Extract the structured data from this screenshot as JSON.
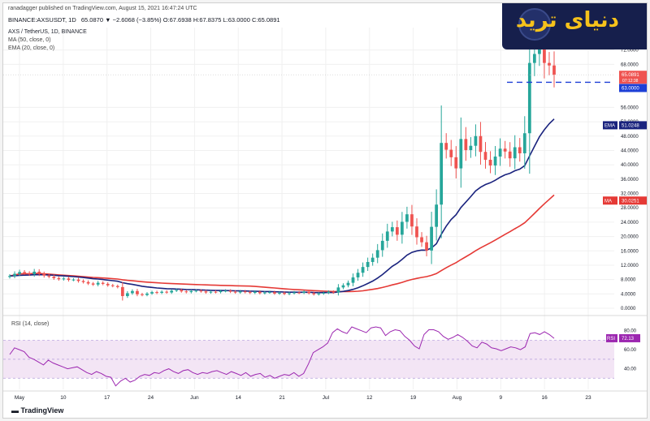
{
  "header": {
    "publish_line": "ranadagger published on TradingView.com, August 15, 2021 16:47:24 UTC",
    "symbol_line": "BINANCE:AXSUSDT, 1D",
    "ohlc": "65.0870 ▼ −2.6068 (−3.85%) O:67.6938 H:67.8375 L:63.0000 C:65.0891",
    "pair_title": "AXS / TetherUS, 1D, BINANCE",
    "ma_legend": "MA (50, close, 0)",
    "ema_legend": "EMA (20, close, 0)",
    "rsi_legend": "RSI (14, close)"
  },
  "watermark": {
    "brand": "دنیای ترید"
  },
  "footer": {
    "tradingview": "TradingView"
  },
  "colors": {
    "up": "#26a69a",
    "down": "#ef5350",
    "ma": "#e53935",
    "ema": "#1a237e",
    "rsi": "#9c27b0",
    "rsi_fill": "#f3e5f5",
    "support": "#1d3fd6"
  },
  "chart_data": [
    {
      "type": "candlestick",
      "title": "AXS / TetherUS, 1D, BINANCE",
      "ylim": [
        0,
        76
      ],
      "y_ticks": [
        "72.0000",
        "68.0000",
        "56.0000",
        "52.0000",
        "48.0000",
        "44.0000",
        "40.0000",
        "36.0000",
        "32.0000",
        "28.0000",
        "24.0000",
        "20.0000",
        "16.0000",
        "12.0000",
        "8.0000",
        "4.0000",
        "0.0000"
      ],
      "x_ticks": [
        "May",
        "10",
        "17",
        "24",
        "Jun",
        "14",
        "21",
        "Jul",
        "12",
        "19",
        "Aug",
        "9",
        "16",
        "23"
      ],
      "price_labels": [
        {
          "name": "last",
          "value": "65.0891",
          "sub": "07:12:38"
        },
        {
          "name": "support",
          "value": "63.0000"
        },
        {
          "name": "EMA",
          "value": "51.0248"
        },
        {
          "name": "MA",
          "value": "30.0251"
        }
      ],
      "support_level": 63.0,
      "closes": [
        9.0,
        9.6,
        10.1,
        9.8,
        9.5,
        10.2,
        9.6,
        9.1,
        8.8,
        8.4,
        8.1,
        8.3,
        7.9,
        8.0,
        7.6,
        7.3,
        6.9,
        6.6,
        7.1,
        6.8,
        6.4,
        6.2,
        5.9,
        3.4,
        4.2,
        4.8,
        3.9,
        3.7,
        4.1,
        4.5,
        4.3,
        4.6,
        4.4,
        4.9,
        5.1,
        4.7,
        4.5,
        4.8,
        4.9,
        4.7,
        4.4,
        4.6,
        4.5,
        4.8,
        4.9,
        4.6,
        4.4,
        4.7,
        4.5,
        4.3,
        4.6,
        4.2,
        4.4,
        4.5,
        4.1,
        4.3,
        4.0,
        4.2,
        4.4,
        4.3,
        4.6,
        4.2,
        3.9,
        4.1,
        4.3,
        4.6,
        4.4,
        5.8,
        6.4,
        7.1,
        8.6,
        9.9,
        11.5,
        12.9,
        14.1,
        16.2,
        18.8,
        21.4,
        22.6,
        20.5,
        24.1,
        26.2,
        22.8,
        19.8,
        18.4,
        16.1,
        22.7,
        28.9,
        46.1,
        44.2,
        42.1,
        39.0,
        47.2,
        44.1,
        45.3,
        48.0,
        43.6,
        41.4,
        39.8,
        42.3,
        44.5,
        43.7,
        41.8,
        44.9,
        43.2,
        48.8,
        68.4,
        70.9,
        72.5,
        68.4,
        67.7,
        65.1
      ],
      "series": [
        {
          "name": "MA (50, close, 0)",
          "last": 30.0251
        },
        {
          "name": "EMA (20, close, 0)",
          "last": 51.0248
        }
      ]
    },
    {
      "type": "line",
      "title": "RSI (14, close)",
      "ylim": [
        20,
        90
      ],
      "y_ticks": [
        "80.00",
        "60.00",
        "40.00"
      ],
      "band": [
        30,
        70
      ],
      "last": "72.13",
      "values": [
        55,
        62,
        60,
        58,
        52,
        50,
        47,
        44,
        49,
        46,
        44,
        42,
        40,
        41,
        42,
        39,
        36,
        34,
        37,
        35,
        32,
        31,
        22,
        27,
        30,
        26,
        28,
        32,
        34,
        33,
        36,
        35,
        38,
        40,
        37,
        35,
        38,
        39,
        36,
        34,
        36,
        35,
        37,
        38,
        36,
        34,
        37,
        35,
        33,
        36,
        32,
        34,
        35,
        31,
        33,
        30,
        32,
        34,
        33,
        36,
        32,
        35,
        45,
        57,
        60,
        63,
        67,
        78,
        82,
        79,
        77,
        84,
        82,
        80,
        78,
        83,
        84,
        83,
        75,
        79,
        81,
        80,
        74,
        70,
        64,
        61,
        76,
        81,
        81,
        79,
        74,
        71,
        73,
        76,
        73,
        69,
        64,
        62,
        68,
        66,
        62,
        61,
        59,
        61,
        63,
        62,
        60,
        63,
        77,
        78,
        76,
        79,
        76,
        72
      ]
    }
  ]
}
